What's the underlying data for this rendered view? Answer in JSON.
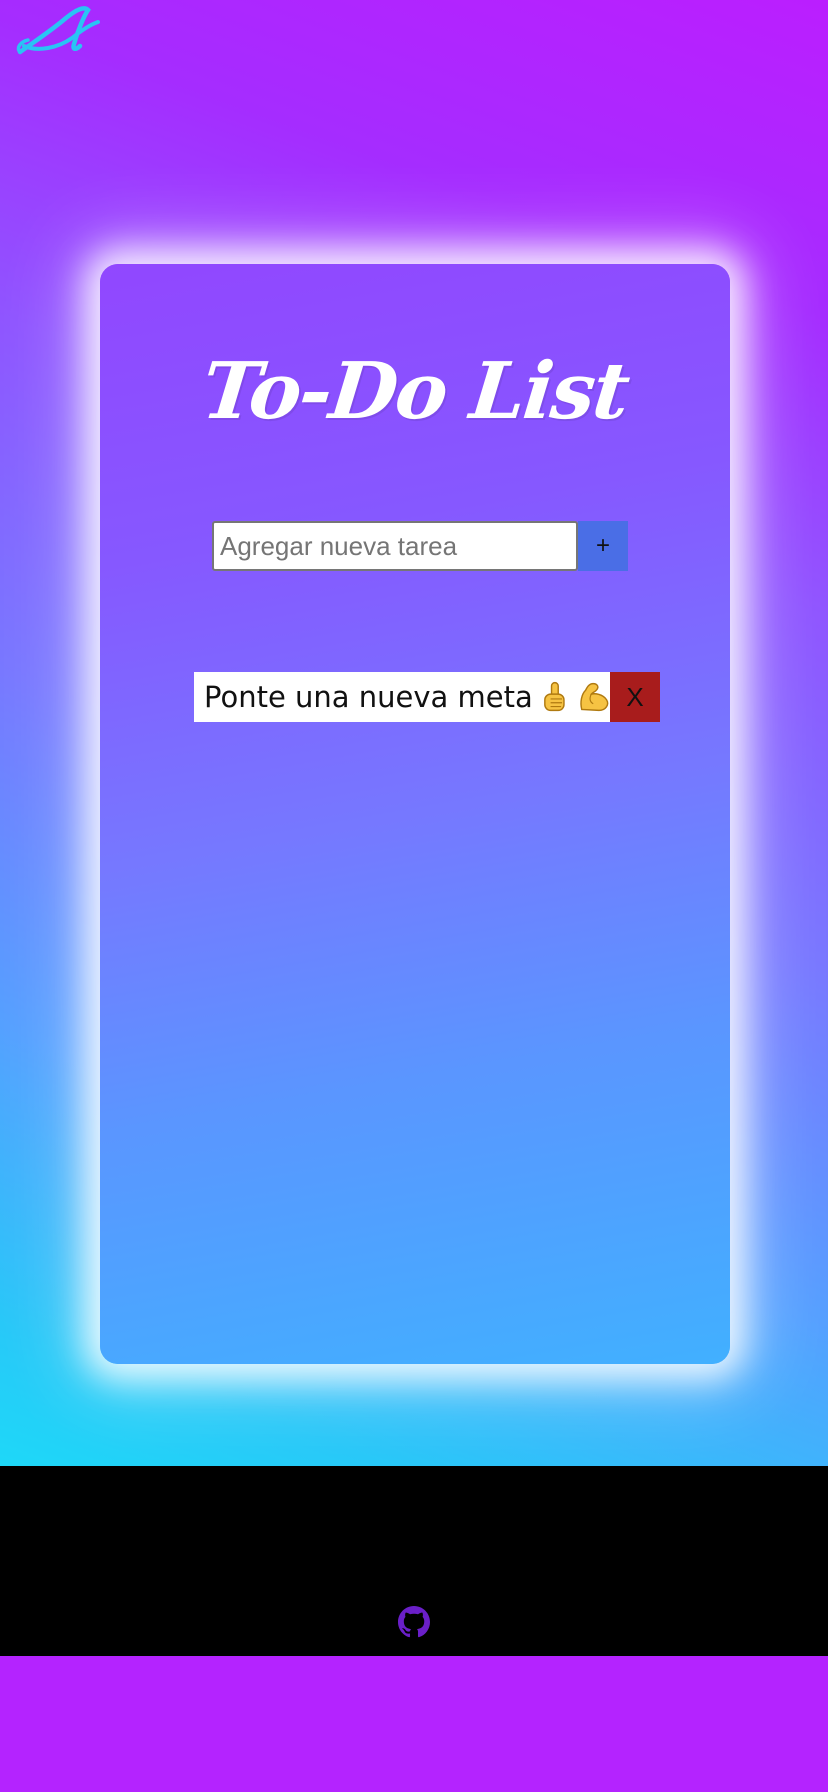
{
  "app": {
    "title": "To-Do List"
  },
  "header": {
    "logo_icon": "signature-logo-icon",
    "logo_color": "#29c4f4"
  },
  "form": {
    "placeholder": "Agregar nueva tarea",
    "value": "",
    "add_label": "+"
  },
  "tasks": [
    {
      "text": "Ponte una nueva meta",
      "emoji_icons": [
        "pointing-up-icon",
        "flexed-biceps-icon"
      ],
      "delete_label": "X"
    }
  ],
  "footer": {
    "github_icon": "github-icon",
    "icon_color": "#6a1fc8"
  },
  "colors": {
    "background_top": "#bb1eff",
    "background_bottom": "#1ed8f8",
    "add_button": "#4a6ee6",
    "delete_button": "#a81c1c",
    "footer": "#000000"
  }
}
